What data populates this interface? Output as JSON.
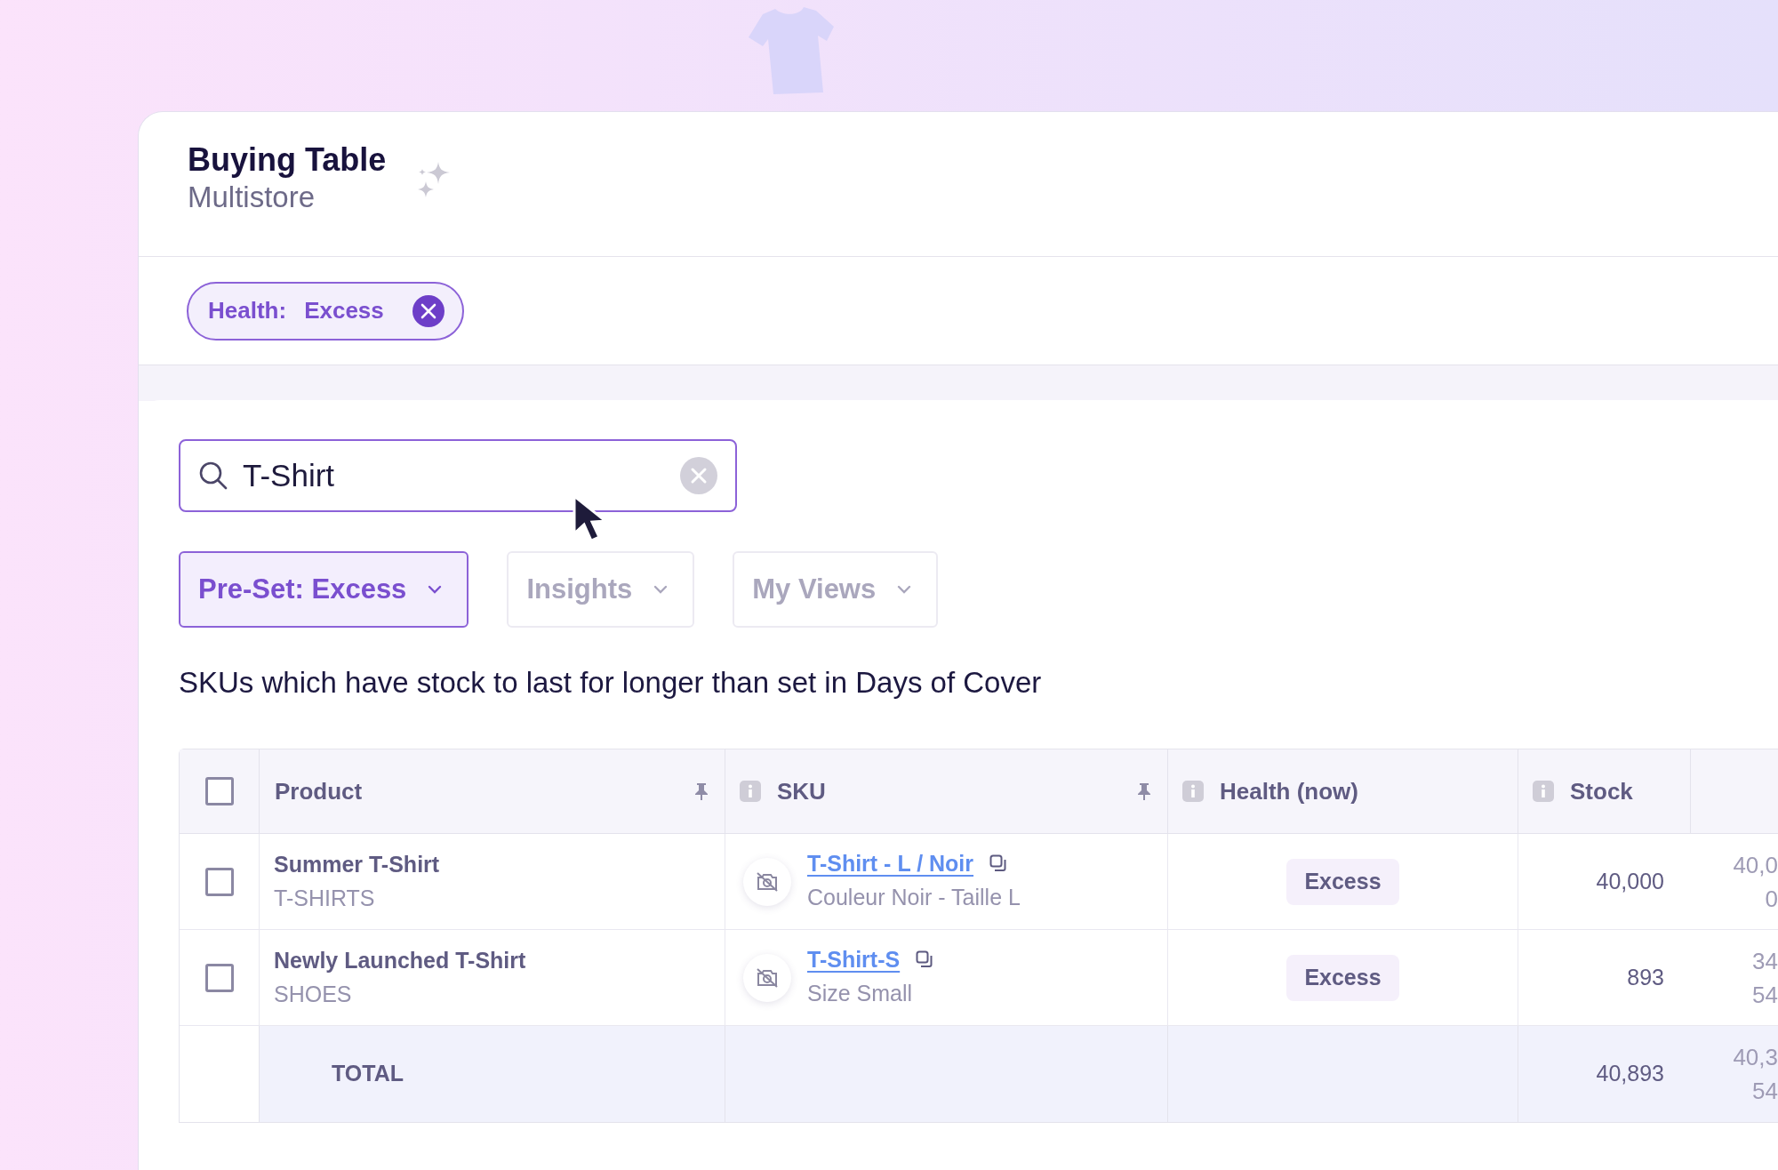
{
  "page": {
    "title": "Buying Table",
    "subtitle": "Multistore"
  },
  "filter_chips": [
    {
      "label": "Health:",
      "value": "Excess"
    }
  ],
  "search": {
    "value": "T-Shirt"
  },
  "dropdowns": [
    {
      "label": "Pre-Set: Excess",
      "selected": true
    },
    {
      "label": "Insights",
      "selected": false
    },
    {
      "label": "My Views",
      "selected": false
    }
  ],
  "description": "SKUs which have stock to last for longer than set in Days of Cover",
  "table": {
    "select_all": {
      "checked": false
    },
    "columns": [
      {
        "label": "Product",
        "info": false,
        "pinned": true
      },
      {
        "label": "SKU",
        "info": true,
        "pinned": true
      },
      {
        "label": "Health (now)",
        "info": true,
        "pinned": false
      },
      {
        "label": "Stock",
        "info": true,
        "pinned": false
      }
    ],
    "rows": [
      {
        "checked": false,
        "product": "Summer T-Shirt",
        "category": "T-SHIRTS",
        "sku": "T-Shirt - L / Noir",
        "variant": "Couleur Noir - Taille L",
        "health": "Excess",
        "stock": "40,000",
        "column_6": [
          "40,0",
          "0"
        ]
      },
      {
        "checked": false,
        "product": "Newly Launched T-Shirt",
        "category": "SHOES",
        "sku": "T-Shirt-S",
        "variant": "Size Small",
        "health": "Excess",
        "stock": "893",
        "column_6": [
          "34",
          "54"
        ]
      }
    ],
    "total": {
      "label": "TOTAL",
      "stock": "40,893",
      "column_6": [
        "40,3",
        "54"
      ]
    }
  }
}
